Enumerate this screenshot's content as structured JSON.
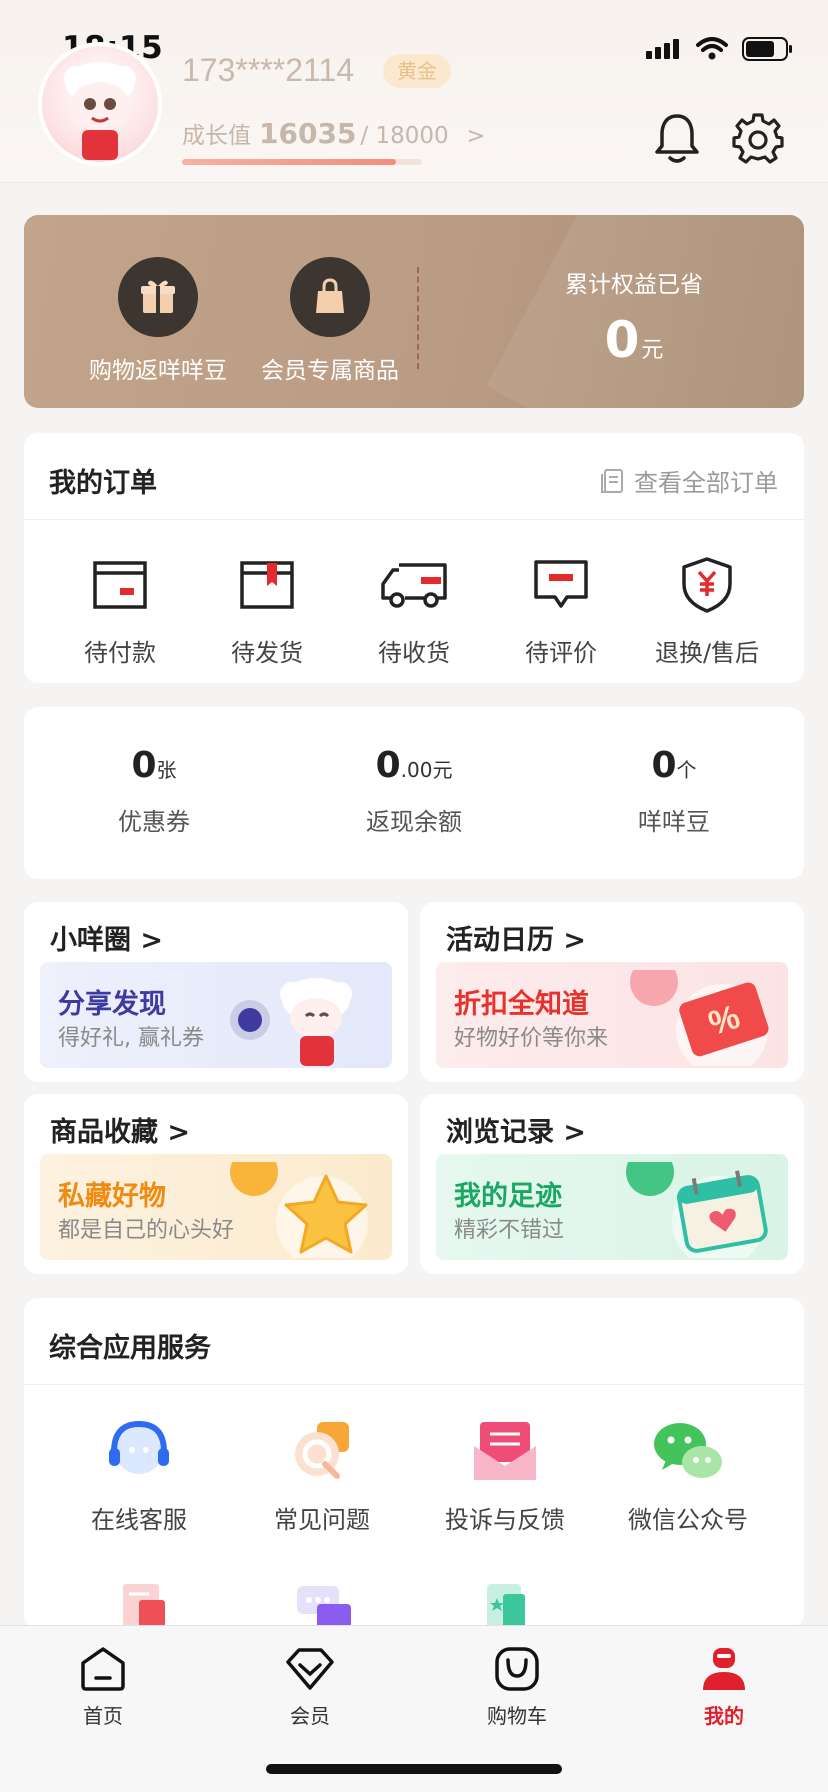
{
  "status_bar": {
    "time": "18:15"
  },
  "profile": {
    "phone": "173****2114",
    "level_badge": "黄金",
    "growth_label": "成长值",
    "growth_value": "16035",
    "growth_total": "/ 18000",
    "growth_arrow": ">",
    "growth_progress": 0.89
  },
  "benefits": {
    "items": [
      {
        "label": "购物返咩咩豆",
        "icon": "gift-icon"
      },
      {
        "label": "会员专属商品",
        "icon": "shopping-bag-icon"
      }
    ],
    "saved_title": "累计权益已省",
    "saved_value": "0",
    "saved_unit": "元"
  },
  "orders": {
    "title": "我的订单",
    "view_all": "查看全部订单",
    "items": [
      {
        "label": "待付款",
        "icon": "wallet-icon"
      },
      {
        "label": "待发货",
        "icon": "package-icon"
      },
      {
        "label": "待收货",
        "icon": "truck-icon"
      },
      {
        "label": "待评价",
        "icon": "comment-icon"
      },
      {
        "label": "退换/售后",
        "icon": "shield-yen-icon"
      }
    ]
  },
  "assets": [
    {
      "value": "0",
      "unit": "张",
      "label": "优惠券"
    },
    {
      "value": "0",
      "decimal": ".00",
      "unit": "元",
      "label": "返现余额"
    },
    {
      "value": "0",
      "unit": "个",
      "label": "咩咩豆"
    }
  ],
  "tiles": [
    {
      "title": "小咩圈 >",
      "banner_title": "分享发现",
      "banner_sub": "得好礼, 赢礼券",
      "color": "#3f3aa0"
    },
    {
      "title": "活动日历 >",
      "banner_title": "折扣全知道",
      "banner_sub": "好物好价等你来",
      "color": "#e5322d"
    },
    {
      "title": "商品收藏 >",
      "banner_title": "私藏好物",
      "banner_sub": "都是自己的心头好",
      "color": "#f08a10"
    },
    {
      "title": "浏览记录 >",
      "banner_title": "我的足迹",
      "banner_sub": "精彩不错过",
      "color": "#18a863"
    }
  ],
  "services": {
    "title": "综合应用服务",
    "items": [
      {
        "label": "在线客服",
        "icon": "headset-icon"
      },
      {
        "label": "常见问题",
        "icon": "question-icon"
      },
      {
        "label": "投诉与反馈",
        "icon": "mail-icon"
      },
      {
        "label": "微信公众号",
        "icon": "wechat-icon"
      }
    ]
  },
  "tabbar": {
    "items": [
      {
        "label": "首页",
        "icon": "home-icon"
      },
      {
        "label": "会员",
        "icon": "member-icon"
      },
      {
        "label": "购物车",
        "icon": "cart-icon"
      },
      {
        "label": "我的",
        "icon": "profile-icon",
        "active": true
      }
    ],
    "active_color": "#e1202e"
  }
}
